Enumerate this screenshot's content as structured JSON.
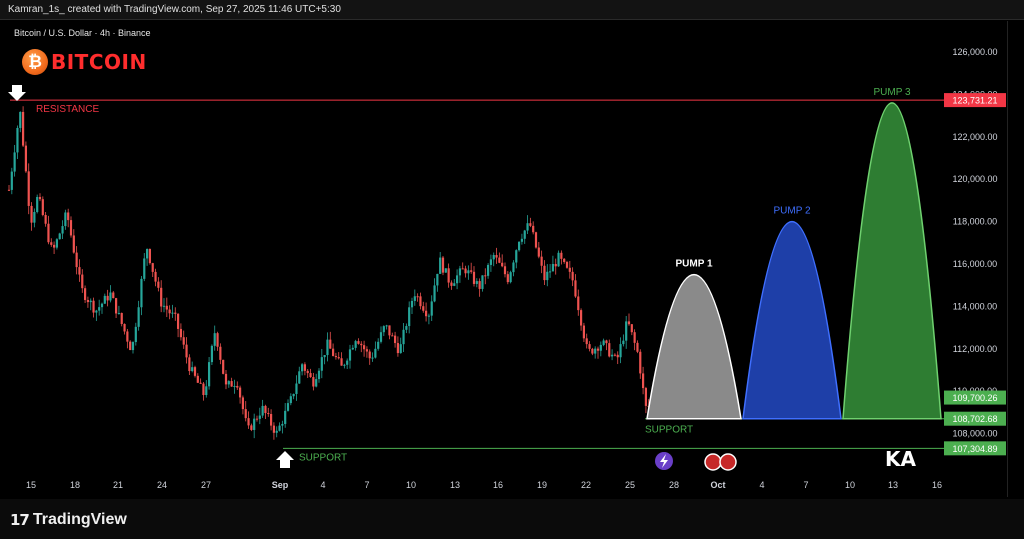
{
  "header": {
    "attribution": "Kamran_1s_ created with TradingView.com, Sep 27, 2025 11:46 UTC+5:30"
  },
  "symbol_label": "Bitcoin / U.S. Dollar · 4h · Binance",
  "logo": {
    "coin_glyph": "₿",
    "text": "BITCOIN"
  },
  "footer": {
    "brand_mark": "17",
    "brand": "TradingView"
  },
  "colors": {
    "up": "#26a69a",
    "down": "#ef5350",
    "resistance": "#f23645",
    "support": "#4caf50",
    "pump1": "#8a8a8a",
    "pump2": "#1e3fa8",
    "pump3": "#2e7d32"
  },
  "chart_data": {
    "type": "candlestick",
    "title": "Bitcoin / U.S. Dollar · 4h · Binance",
    "ylim": [
      106000,
      127000
    ],
    "y_ticks": [
      "108,000.00",
      "110,000.00",
      "112,000.00",
      "114,000.00",
      "116,000.00",
      "118,000.00",
      "120,000.00",
      "122,000.00",
      "124,000.00",
      "126,000.00"
    ],
    "x_ticks": [
      "15",
      "18",
      "21",
      "24",
      "27",
      "Sep",
      "4",
      "7",
      "10",
      "13",
      "16",
      "19",
      "22",
      "25",
      "28",
      "Oct",
      "4",
      "7",
      "10",
      "13",
      "16"
    ],
    "price_path": [
      [
        0,
        119500
      ],
      [
        1.5,
        123300
      ],
      [
        3,
        118000
      ],
      [
        4,
        119200
      ],
      [
        6,
        116500
      ],
      [
        8,
        118400
      ],
      [
        10,
        114800
      ],
      [
        12,
        113800
      ],
      [
        14,
        114600
      ],
      [
        17,
        111900
      ],
      [
        19,
        116900
      ],
      [
        21,
        114200
      ],
      [
        23,
        113400
      ],
      [
        25,
        111100
      ],
      [
        27,
        109800
      ],
      [
        28.5,
        112900
      ],
      [
        30,
        110200
      ],
      [
        31.5,
        110500
      ],
      [
        33,
        108100
      ],
      [
        35,
        109200
      ],
      [
        37,
        108000
      ],
      [
        39,
        109600
      ],
      [
        40.5,
        111300
      ],
      [
        42,
        110400
      ],
      [
        44,
        112200
      ],
      [
        46,
        111100
      ],
      [
        48,
        112600
      ],
      [
        50,
        111500
      ],
      [
        52,
        113100
      ],
      [
        54,
        111900
      ],
      [
        56,
        114700
      ],
      [
        58,
        113600
      ],
      [
        59.5,
        116200
      ],
      [
        61,
        115100
      ],
      [
        63,
        115800
      ],
      [
        65,
        114900
      ],
      [
        67,
        116400
      ],
      [
        69,
        115300
      ],
      [
        70.5,
        117200
      ],
      [
        72,
        117900
      ],
      [
        74,
        115300
      ],
      [
        76,
        116300
      ],
      [
        78,
        115200
      ],
      [
        80,
        111800
      ],
      [
        82,
        112300
      ],
      [
        84,
        111400
      ],
      [
        85.5,
        113300
      ],
      [
        87,
        111700
      ],
      [
        88,
        109200
      ],
      [
        89,
        109400
      ],
      [
        90,
        109700
      ]
    ],
    "levels": [
      {
        "name": "RESISTANCE",
        "value": 123731.21,
        "label": "123,731.21"
      },
      {
        "name": "SUPPORT",
        "value": 107304.89,
        "label": "107,304.89"
      },
      {
        "name": "SUPPORT",
        "value": 108702.68,
        "label": "108,702.68"
      },
      {
        "name": "current",
        "value": 109700.26,
        "label": "109,700.26"
      }
    ],
    "pumps": [
      {
        "name": "PUMP 1",
        "peak": 115500
      },
      {
        "name": "PUMP 2",
        "peak": 118000
      },
      {
        "name": "PUMP 3",
        "peak": 123600
      }
    ]
  },
  "annotations": {
    "resistance_label": "RESISTANCE",
    "support_label_low": "SUPPORT",
    "support_label_high": "SUPPORT",
    "pump1": "PUMP 1",
    "pump2": "PUMP 2",
    "pump3": "PUMP 3",
    "watermark": "KA"
  }
}
